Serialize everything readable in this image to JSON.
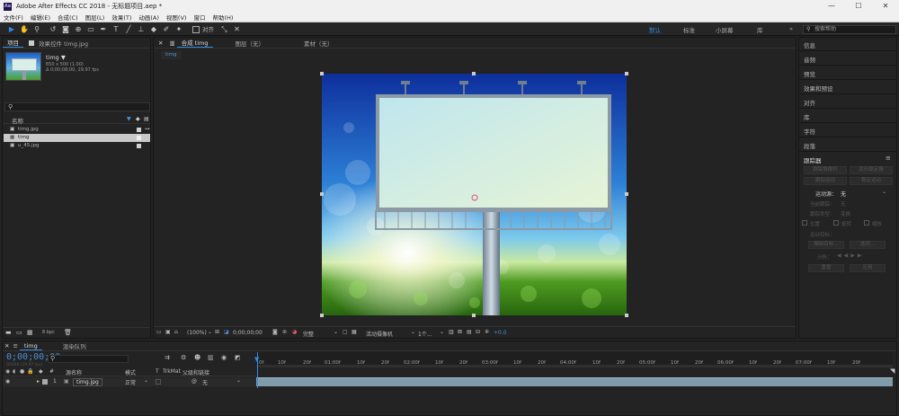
{
  "window": {
    "title": "Adobe After Effects CC 2018 - 无标题项目.aep *",
    "app_badge": "Ae",
    "minimize": "—",
    "maximize": "☐",
    "close": "✕"
  },
  "menu": [
    "文件(F)",
    "编辑(E)",
    "合成(C)",
    "图层(L)",
    "效果(T)",
    "动画(A)",
    "视图(V)",
    "窗口",
    "帮助(H)"
  ],
  "toolbar": {
    "align_label": "对齐",
    "workspaces": [
      "默认",
      "标准",
      "小屏幕",
      "库"
    ],
    "active_workspace": "默认",
    "search_placeholder": "搜索帮助",
    "more": "»"
  },
  "project_panel": {
    "tab_project": "项目",
    "tab_effects": "效果控件 timg.jpg",
    "selected_name": "timg ▼",
    "selected_info1": "650 x 500 (1.00)",
    "selected_info2": "Δ 0;00;08;00, 29.97 fps",
    "search_icon": "⚲",
    "col_name": "名称",
    "files": [
      {
        "name": "timg.jpg",
        "type": "footage"
      },
      {
        "name": "timg",
        "type": "comp"
      },
      {
        "name": "u_4S.jpg",
        "type": "footage"
      }
    ],
    "bpc": "8 bpc"
  },
  "comp_panel": {
    "tab_comp": "合成 timg",
    "tab_layer": "图层（无）",
    "tab_footage": "素材（无）",
    "comp_subtab": "timg",
    "zoom": "(100%)",
    "timecode": "0;00;00;00",
    "quality": "完整",
    "camera": "活动摄像机",
    "views": "1个...",
    "exposure": "+0.0"
  },
  "right_panel": {
    "items": [
      "信息",
      "音频",
      "预览",
      "效果和预设",
      "对齐",
      "库",
      "字符",
      "段落"
    ],
    "tracker": "跟踪器",
    "tracker_buttons": [
      "跟踪摄像机",
      "变形稳定器",
      "跟踪运动",
      "稳定运动"
    ],
    "motion_source_label": "运动源：",
    "motion_source_value": "无",
    "current_track_label": "当前跟踪：",
    "current_track_value": "无",
    "track_type_label": "跟踪类型：",
    "track_type_value": "变换",
    "checks": [
      "位置",
      "旋转",
      "缩放"
    ],
    "motion_target": "运动目标：",
    "edit_target": "编辑目标...",
    "options": "选项...",
    "analyze": "分析：",
    "reset": "重置",
    "apply": "应用"
  },
  "timeline": {
    "tab_comp": "timg",
    "tab_render": "渲染队列",
    "timecode": "0;00;00;00",
    "timecode_sub": "00000 (29.97 fps)",
    "col_source": "源名称",
    "col_mode": "模式",
    "col_t": "T",
    "col_trkmat": "TrkMat",
    "col_parent": "父级和链接",
    "layer_num": "1",
    "layer_name": "timg.jpg",
    "layer_mode": "正常",
    "layer_parent": "无",
    "ruler": [
      "0f",
      "10f",
      "20f",
      "01:00f",
      "10f",
      "20f",
      "02:00f",
      "10f",
      "20f",
      "03:00f",
      "10f",
      "20f",
      "04:00f",
      "10f",
      "20f",
      "05:00f",
      "10f",
      "20f",
      "06:00f",
      "10f",
      "20f",
      "07:00f",
      "10f",
      "20f"
    ]
  }
}
